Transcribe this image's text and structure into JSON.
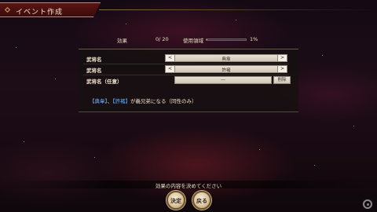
{
  "title": "イベント作成",
  "usage": {
    "effect_label": "効果",
    "effect_count": "0/ 20",
    "usage_label": "使用領域",
    "usage_percent": "1%",
    "usage_fill": 0.01
  },
  "rows": [
    {
      "label": "武将名",
      "left_arrow": "<",
      "value": "典韋",
      "right_arrow": ">"
    },
    {
      "label": "武将名",
      "left_arrow": "<",
      "value": "許褚",
      "right_arrow": ">"
    },
    {
      "label": "武将名（任意）",
      "value": "―",
      "cancel": "削除"
    }
  ],
  "description": {
    "bracket1": "【典韋】",
    "sep": "、",
    "bracket2": "【許褚】",
    "rest": "が義兄弟になる（同性のみ）"
  },
  "instruction": "効果の内容を決めてください",
  "buttons": {
    "ok": "決定",
    "back": "戻る"
  },
  "colors": {
    "accent": "#d4b27a",
    "title_bg": "#5a1414",
    "highlight": "#6fb4ff"
  }
}
